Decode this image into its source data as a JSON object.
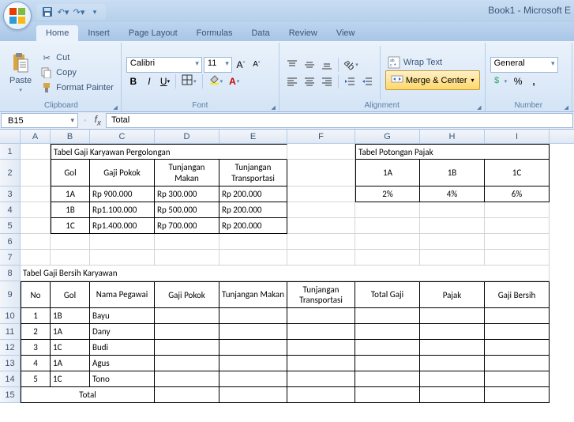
{
  "app": {
    "title": "Book1 - Microsoft E"
  },
  "tabs": [
    "Home",
    "Insert",
    "Page Layout",
    "Formulas",
    "Data",
    "Review",
    "View"
  ],
  "active_tab": "Home",
  "ribbon": {
    "clipboard": {
      "label": "Clipboard",
      "paste": "Paste",
      "cut": "Cut",
      "copy": "Copy",
      "fmtpainter": "Format Painter"
    },
    "font": {
      "label": "Font",
      "name": "Calibri",
      "size": "11"
    },
    "alignment": {
      "label": "Alignment",
      "wrap": "Wrap Text",
      "merge": "Merge & Center"
    },
    "number": {
      "label": "Number",
      "format": "General"
    }
  },
  "namebox": "B15",
  "formula": "Total",
  "columns": [
    "A",
    "B",
    "C",
    "D",
    "E",
    "F",
    "G",
    "H",
    "I"
  ],
  "sheet": {
    "title1": "Tabel Gaji Karyawan Pergolongan",
    "title2": "Tabel Potongan Pajak",
    "hdr1": {
      "gol": "Gol",
      "pokok": "Gaji Pokok",
      "makan": "Tunjangan Makan",
      "trans": "Tunjangan Transportasi"
    },
    "rows1": [
      {
        "gol": "1A",
        "pokok": "Rp   900.000",
        "makan": "Rp  300.000",
        "trans": "Rp   200.000"
      },
      {
        "gol": "1B",
        "pokok": "Rp1.100.000",
        "makan": "Rp  500.000",
        "trans": "Rp   200.000"
      },
      {
        "gol": "1C",
        "pokok": "Rp1.400.000",
        "makan": "Rp  700.000",
        "trans": "Rp   200.000"
      }
    ],
    "tax_hdr": [
      "1A",
      "1B",
      "1C"
    ],
    "tax_vals": [
      "2%",
      "4%",
      "6%"
    ],
    "title3": "Tabel Gaji Bersih Karyawan",
    "hdr2": {
      "no": "No",
      "gol": "Gol",
      "nama": "Nama Pegawai",
      "pokok": "Gaji Pokok",
      "makan": "Tunjangan Makan",
      "trans": "Tunjangan Transportasi",
      "total": "Total Gaji",
      "pajak": "Pajak",
      "bersih": "Gaji Bersih"
    },
    "rows2": [
      {
        "no": "1",
        "gol": "1B",
        "nama": "Bayu"
      },
      {
        "no": "2",
        "gol": "1A",
        "nama": "Dany"
      },
      {
        "no": "3",
        "gol": "1C",
        "nama": "Budi"
      },
      {
        "no": "4",
        "gol": "1A",
        "nama": "Agus"
      },
      {
        "no": "5",
        "gol": "1C",
        "nama": "Tono"
      }
    ],
    "total_label": "Total"
  }
}
